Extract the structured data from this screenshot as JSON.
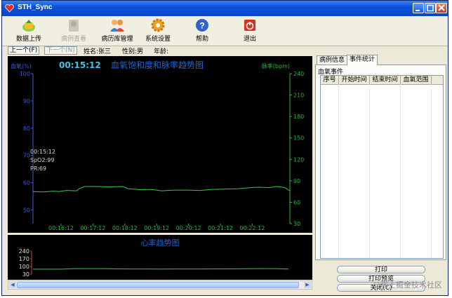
{
  "window": {
    "title": "STH_Sync"
  },
  "toolbar": [
    {
      "label": "数据上传",
      "icon": "data-upload-icon",
      "enabled": true
    },
    {
      "label": "病例查看",
      "icon": "case-view-icon",
      "enabled": false
    },
    {
      "label": "病历库管理",
      "icon": "record-library-icon",
      "enabled": true
    },
    {
      "label": "系统设置",
      "icon": "settings-gear-icon",
      "enabled": true
    },
    {
      "label": "帮助",
      "icon": "help-icon",
      "enabled": true
    },
    {
      "label": "退出",
      "icon": "exit-power-icon",
      "enabled": true
    }
  ],
  "patient": {
    "prev_label": "上一个(F)",
    "next_label": "下一个(N)",
    "name": "姓名:张三",
    "gender": "性别:男",
    "age": "年龄:"
  },
  "main_chart": {
    "time": "00:15:12",
    "title": "血氧饱和度和脉率趋势图",
    "left_label": "血氧(%)",
    "right_label": "脉率(bpm)",
    "cursor": {
      "time": "00:15:12",
      "spo2": "SpO2:99",
      "pr": "PR:69"
    }
  },
  "hr_chart": {
    "title": "心率趋势图"
  },
  "tabs": [
    {
      "label": "病例信息",
      "active": false
    },
    {
      "label": "事件统计",
      "active": true
    }
  ],
  "events": {
    "group_label": "血氧事件",
    "columns": [
      "序号",
      "开始时间",
      "结束时间",
      "血氧范围"
    ],
    "rows": []
  },
  "buttons": {
    "print": "打印",
    "preview": "打印预览",
    "close": "关闭(C)"
  },
  "watermark": "@稀土掘金技术社区",
  "colors": {
    "spo2_axis": "#3f5bd9",
    "pr_axis": "#27b83a",
    "trend_line": "#39c85a",
    "title_blue": "#2a62c9",
    "time_cyan": "#3fc4ea"
  },
  "chart_data": [
    {
      "type": "line",
      "x": [
        "00:16:12",
        "00:17:12",
        "00:18:12",
        "00:19:12",
        "00:20:12",
        "00:21:12",
        "00:22:12"
      ],
      "yticks_left": [
        50,
        60,
        70,
        80,
        90,
        100
      ],
      "yticks_right": [
        30,
        60,
        90,
        120,
        150,
        180,
        210,
        240
      ],
      "ylim": [
        45,
        100
      ],
      "y2lim": [
        30,
        240
      ],
      "series": [
        {
          "axis": "right",
          "values": [
            [
              0,
              75
            ],
            [
              0.04,
              74.5
            ],
            [
              0.08,
              75.5
            ],
            [
              0.1,
              75
            ],
            [
              0.13,
              76.5
            ],
            [
              0.17,
              76
            ],
            [
              0.18,
              79
            ],
            [
              0.2,
              82
            ],
            [
              0.25,
              82
            ],
            [
              0.3,
              81.5
            ],
            [
              0.35,
              82
            ],
            [
              0.37,
              79
            ],
            [
              0.42,
              77.5
            ],
            [
              0.46,
              78
            ],
            [
              0.5,
              76
            ],
            [
              0.55,
              77
            ],
            [
              0.6,
              77
            ],
            [
              0.65,
              76.5
            ],
            [
              0.7,
              78
            ],
            [
              0.75,
              78.5
            ],
            [
              0.8,
              79
            ],
            [
              0.85,
              80.5
            ],
            [
              0.88,
              81
            ],
            [
              0.92,
              80.5
            ],
            [
              0.95,
              82
            ],
            [
              0.98,
              80.5
            ],
            [
              1,
              76
            ]
          ]
        }
      ]
    },
    {
      "type": "line",
      "title": "心率趋势图",
      "yticks": [
        30,
        100,
        170,
        240
      ],
      "ylim": [
        30,
        240
      ],
      "series": [
        {
          "values": [
            75,
            75,
            75,
            80,
            80,
            80,
            78,
            77,
            77,
            76,
            77,
            77,
            77,
            78,
            78,
            79,
            80,
            80,
            76
          ]
        }
      ]
    }
  ]
}
